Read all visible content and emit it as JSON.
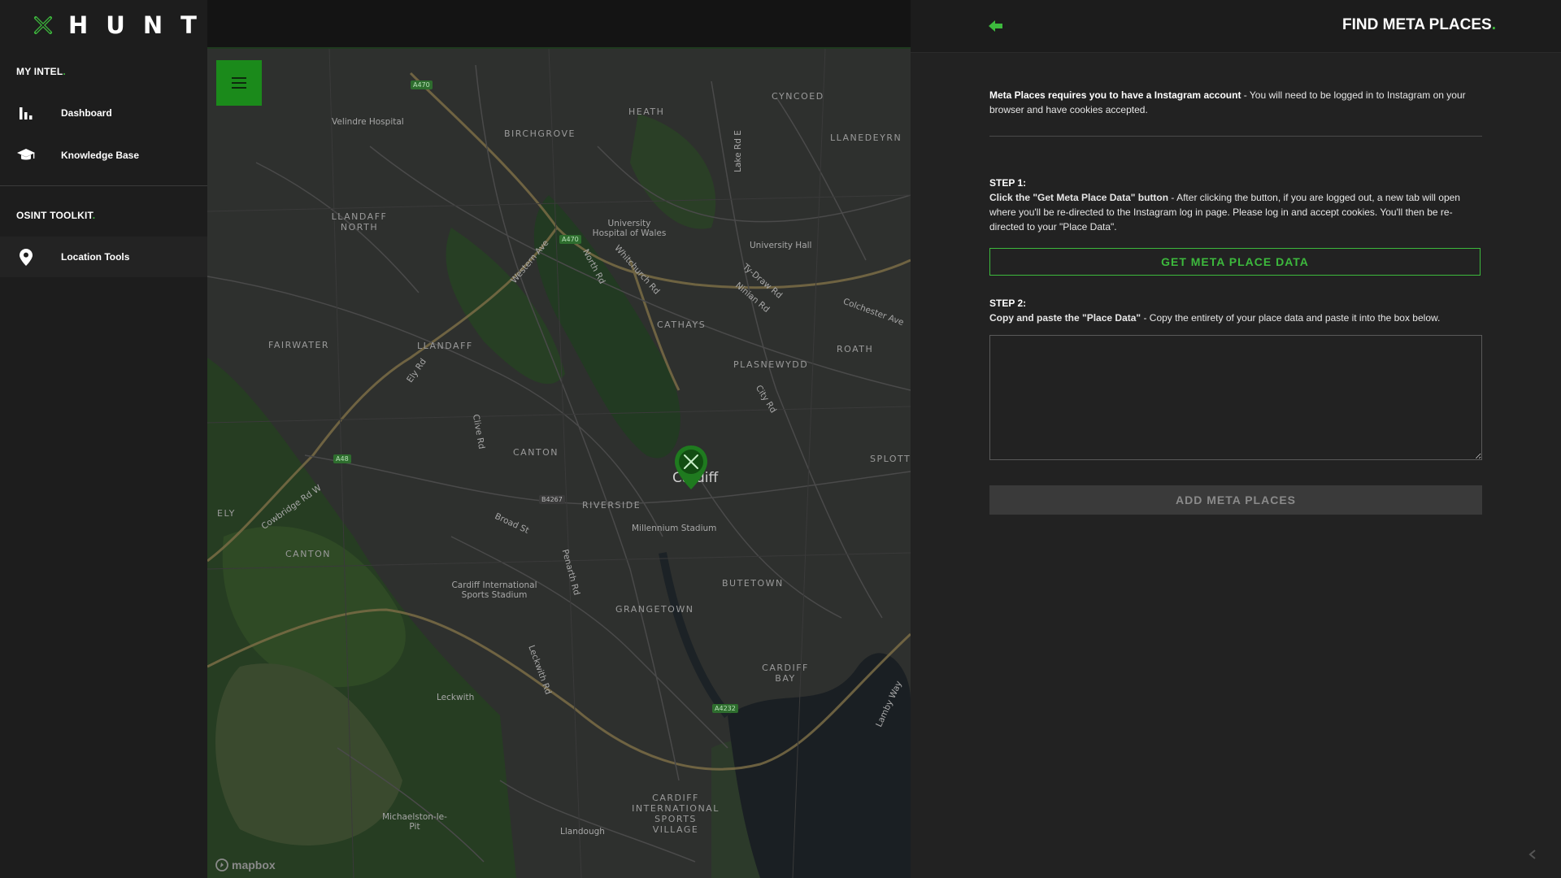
{
  "brand": {
    "name": "HUNT",
    "accent_color": "#3db93d"
  },
  "sidebar": {
    "sections": [
      {
        "label": "MY INTEL",
        "dot": "."
      },
      {
        "label": "OSINT TOOLKIT",
        "dot": "."
      }
    ],
    "items": [
      {
        "label": "Dashboard",
        "icon": "bar-chart-icon"
      },
      {
        "label": "Knowledge Base",
        "icon": "graduation-cap-icon"
      },
      {
        "label": "Location Tools",
        "icon": "map-pin-icon"
      }
    ]
  },
  "map": {
    "attribution": "mapbox",
    "places": [
      "CYNCOED",
      "LLANEDEYRN",
      "HEATH",
      "BIRCHGROVE",
      "LLANDAFF NORTH",
      "FAIRWATER",
      "LLANDAFF",
      "CATHAYS",
      "ROATH",
      "PLASNEWYDD",
      "CANTON",
      "SPLOTT",
      "RIVERSIDE",
      "ELY",
      "CANTON",
      "GRANGETOWN",
      "BUTETOWN",
      "CARDIFF BAY",
      "CARDIFF INTERNATIONAL SPORTS VILLAGE"
    ],
    "pois": [
      "Velindre Hospital",
      "University Hospital of Wales",
      "University Hall",
      "Millennium Stadium",
      "Cardiff International Sports Stadium",
      "Leckwith",
      "Michaelston-le-Pit",
      "Llandough"
    ],
    "streets": [
      "Western Ave",
      "North Rd",
      "Whitchurch Rd",
      "Ty-Draw Rd",
      "Ninian Rd",
      "Colchester Ave",
      "City Rd",
      "Clive Rd",
      "Cowbridge Rd W",
      "Broad St",
      "Lake Rd E",
      "Ely Rd",
      "Penarth Rd",
      "Leckwith Rd",
      "Lamby Way"
    ],
    "city": "Cardiff",
    "road_shields": [
      "A470",
      "A470",
      "A48",
      "B4267",
      "A4232"
    ]
  },
  "panel": {
    "title": "FIND META PLACES",
    "title_dot": ".",
    "intro_bold": "Meta Places requires you to have a Instagram account",
    "intro_text": " - You will need to be logged in to Instagram on your browser and have cookies accepted.",
    "step1": {
      "title": "STEP 1:",
      "bold": "Click the \"Get Meta Place Data\" button",
      "text": " - After clicking the button, if you are logged out, a new tab will open where you'll be re-directed to the Instagram log in page. Please log in and accept cookies. You'll then be re-directed to your \"Place Data\"."
    },
    "get_button": "GET META PLACE DATA",
    "step2": {
      "title": "STEP 2:",
      "bold": "Copy and paste the \"Place Data\"",
      "text": " - Copy the entirety of your place data and paste it into the box below."
    },
    "textarea_value": "",
    "add_button": "ADD META PLACES"
  }
}
